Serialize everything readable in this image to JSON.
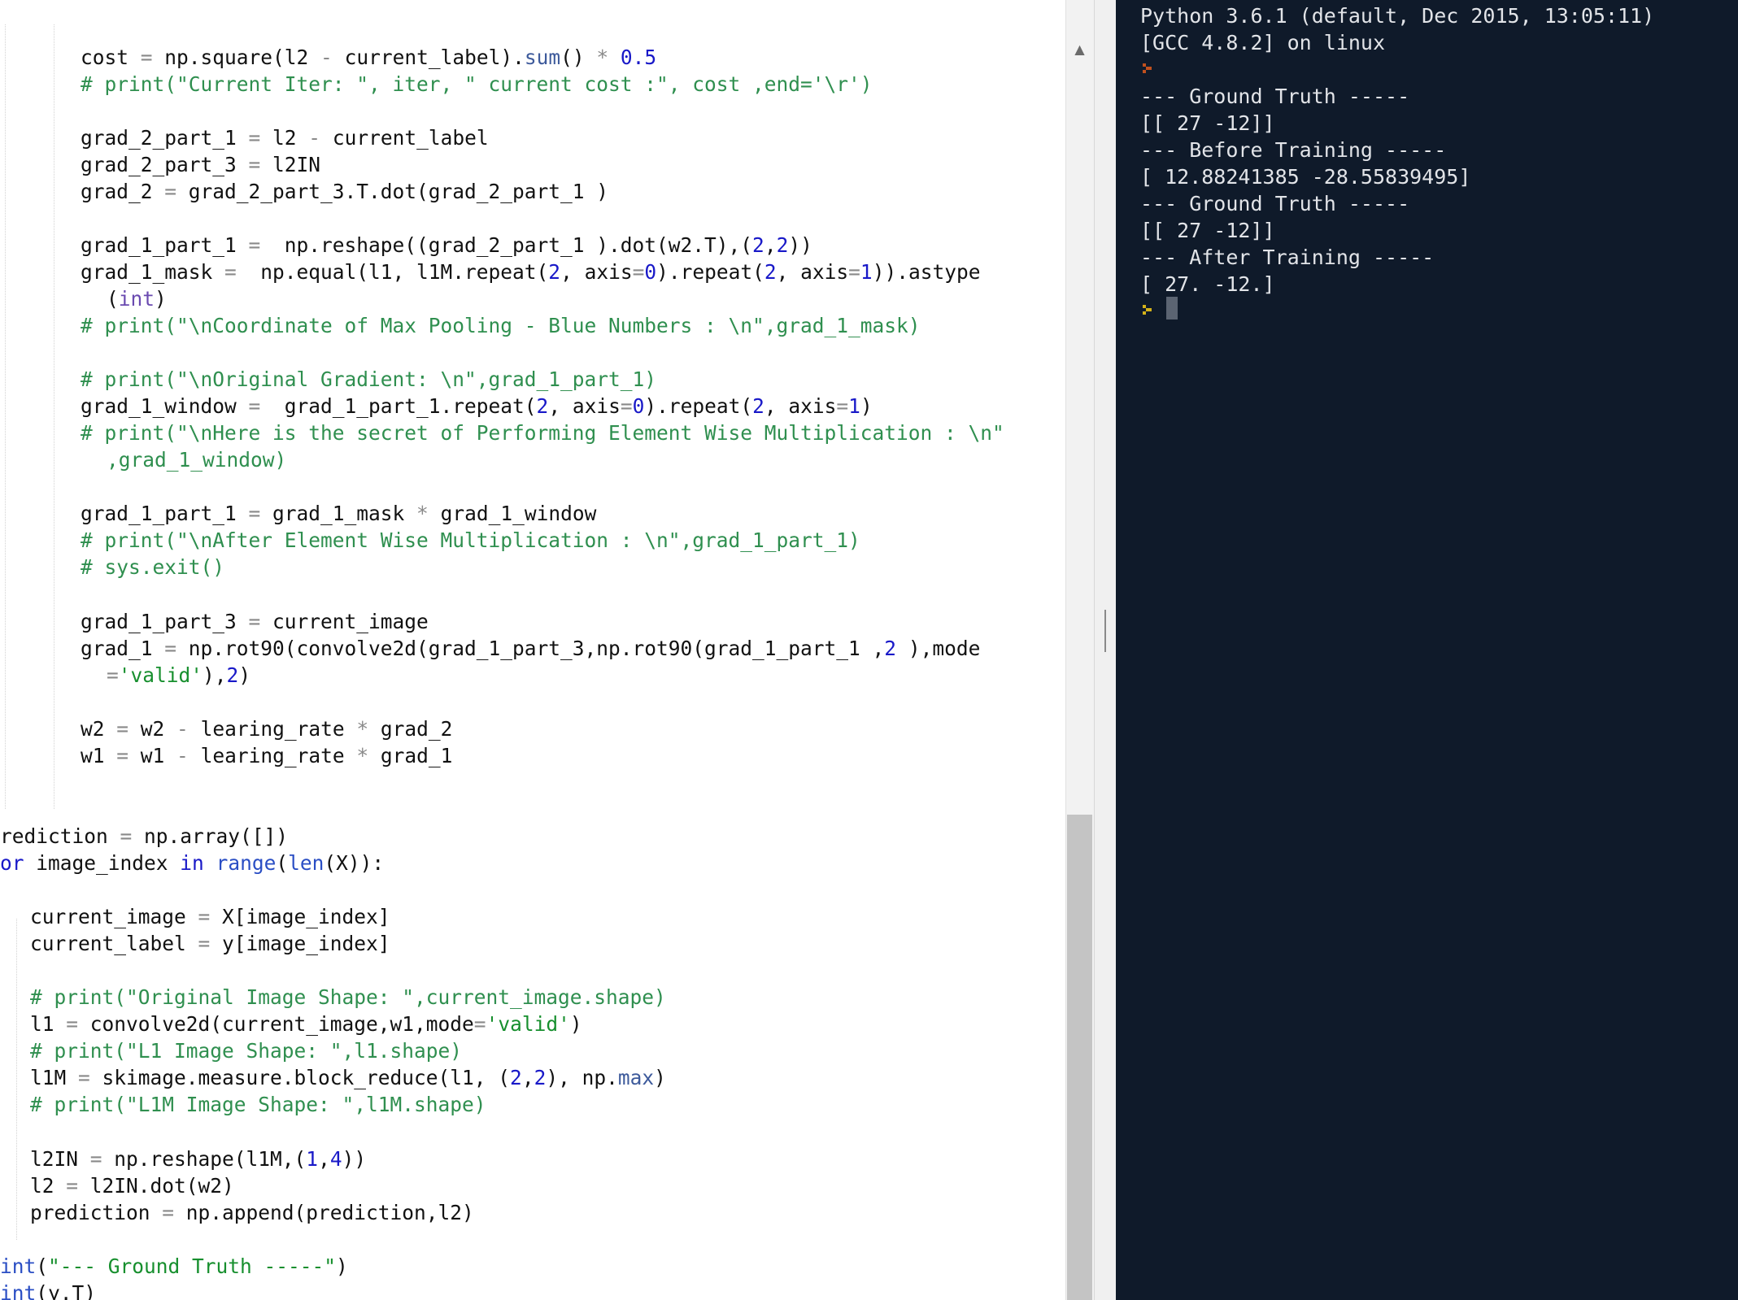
{
  "editor": {
    "colors": {
      "background": "#ffffff",
      "text": "#111111",
      "operator": "#8a8a8a",
      "number": "#1919c8",
      "string": "#178f2e",
      "comment": "#2f8f4f",
      "keyword": "#1919c8"
    },
    "lines": [
      {
        "i": 2,
        "t": [
          [
            "cost ",
            ""
          ],
          [
            "=",
            "op"
          ],
          [
            " np.square(l2 ",
            ""
          ],
          [
            "-",
            "op"
          ],
          [
            " current_label).",
            ""
          ],
          [
            "sum",
            "attr"
          ],
          [
            "() ",
            ""
          ],
          [
            "*",
            "op"
          ],
          [
            " ",
            ""
          ],
          [
            "0.5",
            "num"
          ]
        ]
      },
      {
        "i": 2,
        "t": [
          [
            "# print(\"Current Iter: \", iter, \" current cost :\", cost ,end='\\r')",
            "cmt"
          ]
        ]
      },
      {
        "i": 2,
        "t": []
      },
      {
        "i": 2,
        "t": [
          [
            "grad_2_part_1 ",
            ""
          ],
          [
            "=",
            "op"
          ],
          [
            " l2 ",
            ""
          ],
          [
            "-",
            "op"
          ],
          [
            " current_label",
            ""
          ]
        ]
      },
      {
        "i": 2,
        "t": [
          [
            "grad_2_part_3 ",
            ""
          ],
          [
            "=",
            "op"
          ],
          [
            " l2IN",
            ""
          ]
        ]
      },
      {
        "i": 2,
        "t": [
          [
            "grad_2 ",
            ""
          ],
          [
            "=",
            "op"
          ],
          [
            " grad_2_part_3.T.dot(grad_2_part_1 )",
            ""
          ]
        ]
      },
      {
        "i": 2,
        "t": []
      },
      {
        "i": 2,
        "t": [
          [
            "grad_1_part_1 ",
            ""
          ],
          [
            "=",
            "op"
          ],
          [
            "  np.reshape((grad_2_part_1 ).dot(w2.T),(",
            ""
          ],
          [
            "2",
            "num"
          ],
          [
            ",",
            ""
          ],
          [
            "2",
            "num"
          ],
          [
            "))",
            ""
          ]
        ]
      },
      {
        "i": 2,
        "t": [
          [
            "grad_1_mask ",
            ""
          ],
          [
            "=",
            "op"
          ],
          [
            "  np.equal(l1, l1M.repeat(",
            ""
          ],
          [
            "2",
            "num"
          ],
          [
            ", axis",
            ""
          ],
          [
            "=",
            "op"
          ],
          [
            "0",
            "num"
          ],
          [
            ").repeat(",
            ""
          ],
          [
            "2",
            "num"
          ],
          [
            ", axis",
            ""
          ],
          [
            "=",
            "op"
          ],
          [
            "1",
            "num"
          ],
          [
            ")).astype",
            ""
          ]
        ]
      },
      {
        "i": 3,
        "t": [
          [
            "(",
            ""
          ],
          [
            "int",
            "bi"
          ],
          [
            ")",
            ""
          ]
        ]
      },
      {
        "i": 2,
        "t": [
          [
            "# print(\"\\nCoordinate of Max Pooling - Blue Numbers : \\n\",grad_1_mask)",
            "cmt"
          ]
        ]
      },
      {
        "i": 2,
        "t": []
      },
      {
        "i": 2,
        "t": [
          [
            "# print(\"\\nOriginal Gradient: \\n\",grad_1_part_1)",
            "cmt"
          ]
        ]
      },
      {
        "i": 2,
        "t": [
          [
            "grad_1_window ",
            ""
          ],
          [
            "=",
            "op"
          ],
          [
            "  grad_1_part_1.repeat(",
            ""
          ],
          [
            "2",
            "num"
          ],
          [
            ", axis",
            ""
          ],
          [
            "=",
            "op"
          ],
          [
            "0",
            "num"
          ],
          [
            ").repeat(",
            ""
          ],
          [
            "2",
            "num"
          ],
          [
            ", axis",
            ""
          ],
          [
            "=",
            "op"
          ],
          [
            "1",
            "num"
          ],
          [
            ")",
            ""
          ]
        ]
      },
      {
        "i": 2,
        "t": [
          [
            "# print(\"\\nHere is the secret of Performing Element Wise Multiplication : \\n\"",
            "cmt"
          ]
        ]
      },
      {
        "i": 3,
        "t": [
          [
            ",grad_1_window)",
            "cmt"
          ]
        ]
      },
      {
        "i": 2,
        "t": []
      },
      {
        "i": 2,
        "t": [
          [
            "grad_1_part_1 ",
            ""
          ],
          [
            "=",
            "op"
          ],
          [
            " grad_1_mask ",
            ""
          ],
          [
            "*",
            "op"
          ],
          [
            " grad_1_window",
            ""
          ]
        ]
      },
      {
        "i": 2,
        "t": [
          [
            "# print(\"\\nAfter Element Wise Multiplication : \\n\",grad_1_part_1)",
            "cmt"
          ]
        ]
      },
      {
        "i": 2,
        "t": [
          [
            "# sys.exit()",
            "cmt"
          ]
        ]
      },
      {
        "i": 2,
        "t": []
      },
      {
        "i": 2,
        "t": [
          [
            "grad_1_part_3 ",
            ""
          ],
          [
            "=",
            "op"
          ],
          [
            " current_image",
            ""
          ]
        ]
      },
      {
        "i": 2,
        "t": [
          [
            "grad_1 ",
            ""
          ],
          [
            "=",
            "op"
          ],
          [
            " np.rot90(convolve2d(grad_1_part_3,np.rot90(grad_1_part_1 ,",
            ""
          ],
          [
            "2",
            "num"
          ],
          [
            " ),mode",
            ""
          ]
        ]
      },
      {
        "i": 3,
        "t": [
          [
            "=",
            "op"
          ],
          [
            "'valid'",
            "str"
          ],
          [
            "),",
            ""
          ],
          [
            "2",
            "num"
          ],
          [
            ")",
            ""
          ]
        ]
      },
      {
        "i": 2,
        "t": []
      },
      {
        "i": 2,
        "t": [
          [
            "w2 ",
            ""
          ],
          [
            "=",
            "op"
          ],
          [
            " w2 ",
            ""
          ],
          [
            "-",
            "op"
          ],
          [
            " learing_rate ",
            ""
          ],
          [
            "*",
            "op"
          ],
          [
            " grad_2",
            ""
          ]
        ]
      },
      {
        "i": 2,
        "t": [
          [
            "w1 ",
            ""
          ],
          [
            "=",
            "op"
          ],
          [
            " w1 ",
            ""
          ],
          [
            "-",
            "op"
          ],
          [
            " learing_rate ",
            ""
          ],
          [
            "*",
            "op"
          ],
          [
            " grad_1",
            ""
          ]
        ]
      },
      {
        "i": 2,
        "t": []
      },
      {
        "i": 0,
        "t": []
      },
      {
        "i": 0,
        "t": [
          [
            "rediction ",
            ""
          ],
          [
            "=",
            "op"
          ],
          [
            " np.array([])",
            ""
          ]
        ]
      },
      {
        "i": 0,
        "t": [
          [
            "or",
            "kw"
          ],
          [
            " image_index ",
            ""
          ],
          [
            "in",
            "kw"
          ],
          [
            " ",
            ""
          ],
          [
            "range",
            "fn"
          ],
          [
            "(",
            ""
          ],
          [
            "len",
            "fn"
          ],
          [
            "(X)):",
            ""
          ]
        ]
      },
      {
        "i": 0,
        "t": []
      },
      {
        "i": 1,
        "t": [
          [
            "current_image ",
            ""
          ],
          [
            "=",
            "op"
          ],
          [
            " X[image_index]",
            ""
          ]
        ]
      },
      {
        "i": 1,
        "t": [
          [
            "current_label ",
            ""
          ],
          [
            "=",
            "op"
          ],
          [
            " y[image_index]",
            ""
          ]
        ]
      },
      {
        "i": 1,
        "t": []
      },
      {
        "i": 1,
        "t": [
          [
            "# print(\"Original Image Shape: \",current_image.shape)",
            "cmt"
          ]
        ]
      },
      {
        "i": 1,
        "t": [
          [
            "l1 ",
            ""
          ],
          [
            "=",
            "op"
          ],
          [
            " convolve2d(current_image,w1,mode",
            ""
          ],
          [
            "=",
            "op"
          ],
          [
            "'valid'",
            "str"
          ],
          [
            ")",
            ""
          ]
        ]
      },
      {
        "i": 1,
        "t": [
          [
            "# print(\"L1 Image Shape: \",l1.shape)",
            "cmt"
          ]
        ]
      },
      {
        "i": 1,
        "t": [
          [
            "l1M ",
            ""
          ],
          [
            "=",
            "op"
          ],
          [
            " skimage.measure.block_reduce(l1, (",
            ""
          ],
          [
            "2",
            "num"
          ],
          [
            ",",
            ""
          ],
          [
            "2",
            "num"
          ],
          [
            "), np.",
            ""
          ],
          [
            "max",
            "attr"
          ],
          [
            ")",
            ""
          ]
        ]
      },
      {
        "i": 1,
        "t": [
          [
            "# print(\"L1M Image Shape: \",l1M.shape)",
            "cmt"
          ]
        ]
      },
      {
        "i": 1,
        "t": []
      },
      {
        "i": 1,
        "t": [
          [
            "l2IN ",
            ""
          ],
          [
            "=",
            "op"
          ],
          [
            " np.reshape(l1M,(",
            ""
          ],
          [
            "1",
            "num"
          ],
          [
            ",",
            ""
          ],
          [
            "4",
            "num"
          ],
          [
            "))",
            ""
          ]
        ]
      },
      {
        "i": 1,
        "t": [
          [
            "l2 ",
            ""
          ],
          [
            "=",
            "op"
          ],
          [
            " l2IN.dot(w2)",
            ""
          ]
        ]
      },
      {
        "i": 1,
        "t": [
          [
            "prediction ",
            ""
          ],
          [
            "=",
            "op"
          ],
          [
            " np.append(prediction,l2)",
            ""
          ]
        ]
      },
      {
        "i": 0,
        "t": []
      },
      {
        "i": 0,
        "t": [
          [
            "int",
            "fn"
          ],
          [
            "(",
            ""
          ],
          [
            "\"--- Ground Truth -----\"",
            "str"
          ],
          [
            ")",
            ""
          ]
        ]
      },
      {
        "i": 0,
        "t": [
          [
            "int",
            "fn"
          ],
          [
            "(y.T)",
            ""
          ]
        ]
      }
    ]
  },
  "scrollbar": {
    "up_arrow": "▲",
    "icon": "scroll-up-arrow-icon"
  },
  "console": {
    "colors": {
      "background": "#0f1a2a",
      "text": "#e2e4e8",
      "prompt_first": "#c0501e",
      "prompt": "#d4b21a"
    },
    "lines": [
      "Python 3.6.1 (default, Dec 2015, 13:05:11)",
      "[GCC 4.8.2] on linux",
      "",
      "--- Ground Truth -----",
      "[[ 27 -12]]",
      "--- Before Training -----",
      "[ 12.88241385 -28.55839495]",
      "--- Ground Truth -----",
      "[[ 27 -12]]",
      "--- After Training -----",
      "[ 27. -12.]",
      ""
    ],
    "prompt_icon": "prompt-arrow-icon"
  }
}
